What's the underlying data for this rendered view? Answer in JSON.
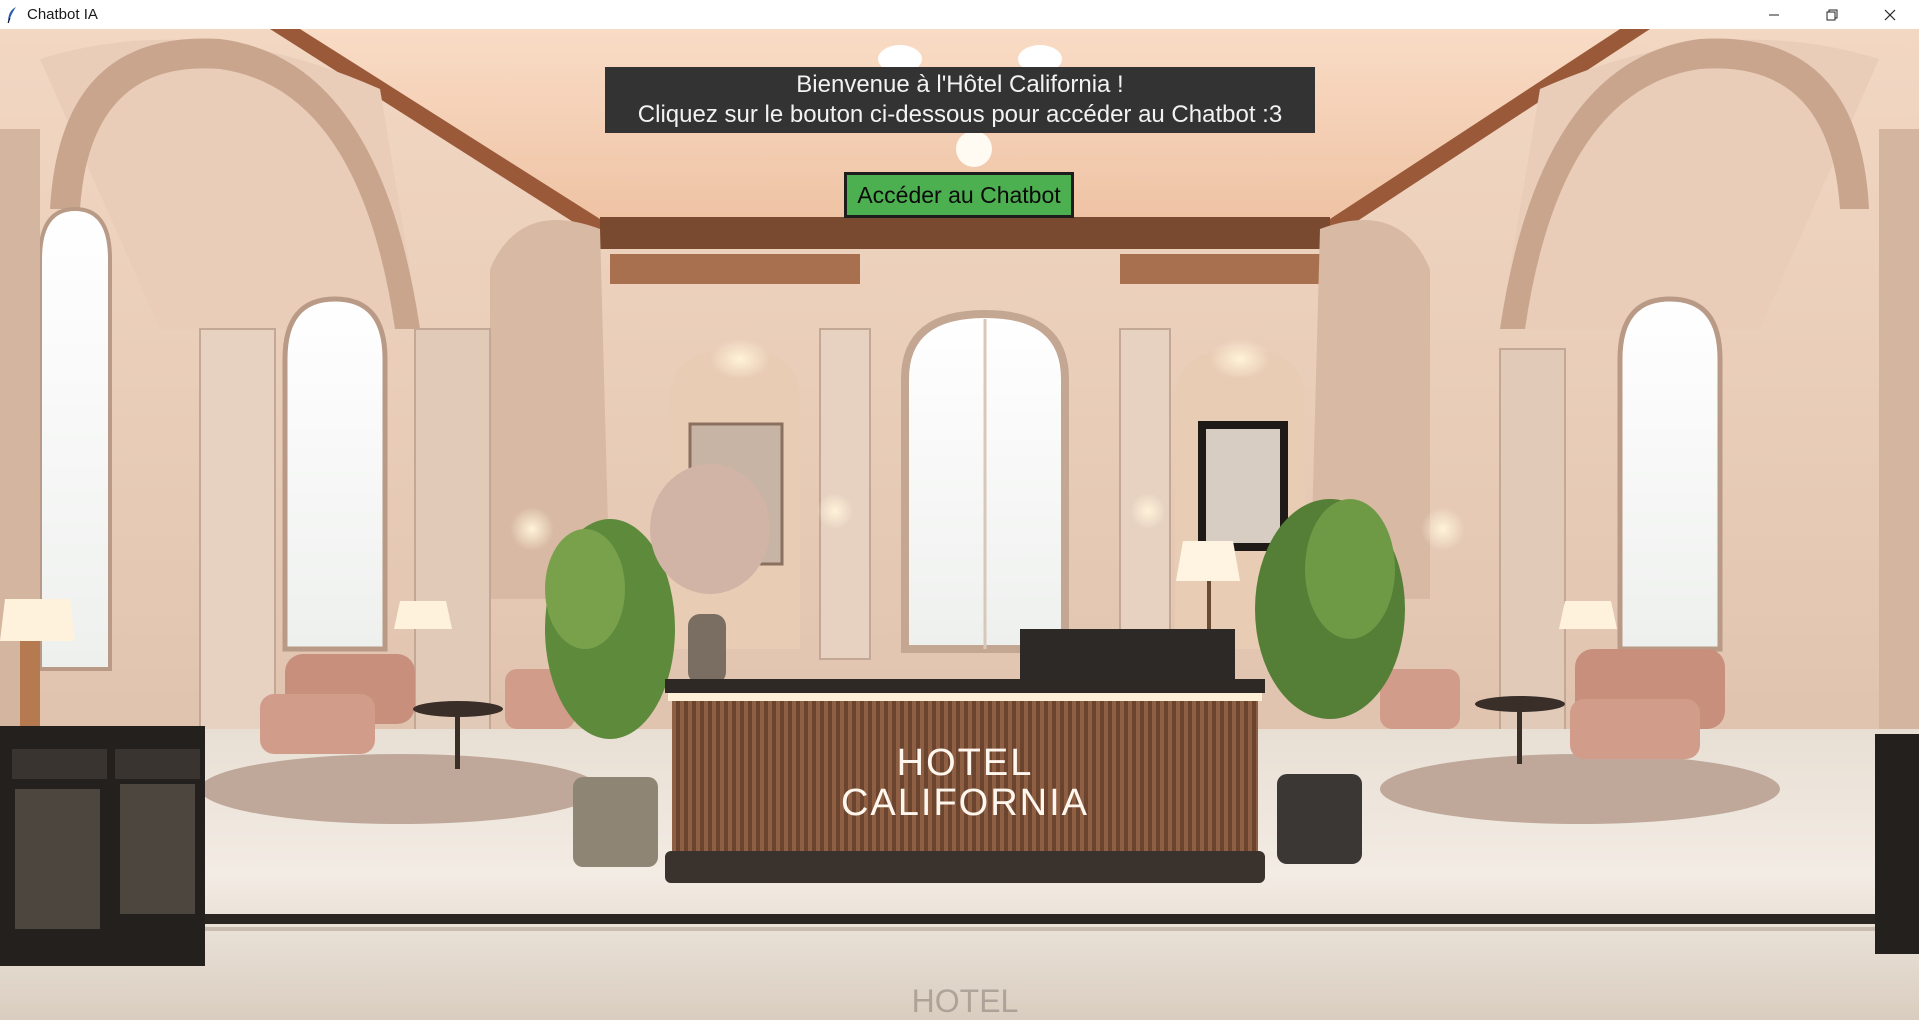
{
  "window": {
    "title": "Chatbot IA",
    "app_icon": "feather-icon",
    "controls": [
      "minimize-icon",
      "restore-icon",
      "close-icon"
    ]
  },
  "welcome": {
    "line1": "Bienvenue à l'Hôtel California !",
    "line2": "Cliquez sur le bouton ci-dessous pour accéder au Chatbot :3"
  },
  "chat_button": {
    "label": "Accéder au Chatbot"
  },
  "background": {
    "sign_line1": "HOTEL",
    "sign_line2": "CALIFORNIA",
    "reflection": "HOTEL"
  },
  "colors": {
    "welcome_bg": "#333333",
    "button_bg": "#4caf50",
    "button_border": "#1d1d1d"
  }
}
